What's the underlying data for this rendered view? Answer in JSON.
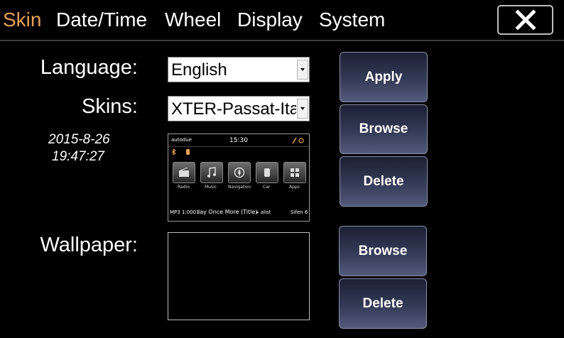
{
  "tabs": [
    {
      "label": "Skin",
      "active": true
    },
    {
      "label": "Date/Time",
      "active": false
    },
    {
      "label": "Wheel",
      "active": false
    },
    {
      "label": "Display",
      "active": false
    },
    {
      "label": "System",
      "active": false
    }
  ],
  "close_icon": "close-x-icon",
  "language": {
    "label": "Language:",
    "value": "English"
  },
  "skins": {
    "label": "Skins:",
    "value": "XTER-Passat-Italy"
  },
  "datetime": {
    "date": "2015-8-26",
    "time": "19:47:27"
  },
  "buttons": {
    "apply": "Apply",
    "skin_browse": "Browse",
    "skin_delete": "Delete",
    "wallpaper_browse": "Browse",
    "wallpaper_delete": "Delete"
  },
  "wallpaper": {
    "label": "Wallpaper:"
  },
  "preview": {
    "top_left": "autodue",
    "clock": "15:30",
    "tiles": [
      "Radio",
      "Music",
      "Navigation",
      "Car",
      "Apps"
    ],
    "bottom_left": "MP3 1:0001",
    "track": "lay Once More (Title)",
    "bottom_mid": "▸ alist",
    "bottom_right": "Sifen 6"
  },
  "colors": {
    "active_tab": "#e8a055",
    "background": "#000000",
    "button_top": "#1b2033",
    "button_bottom": "#53597a"
  }
}
